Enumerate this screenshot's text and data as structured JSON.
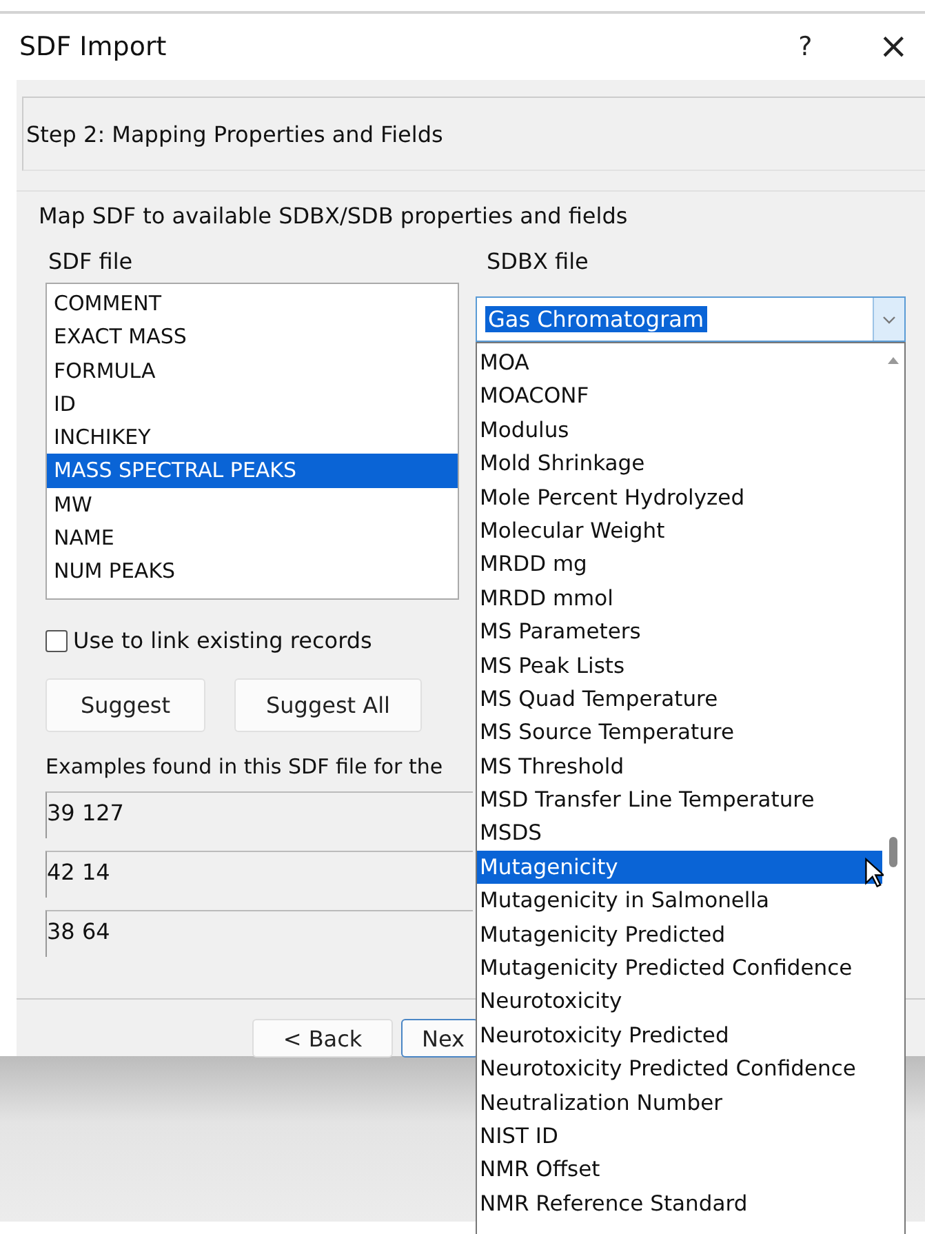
{
  "window": {
    "title": "SDF Import",
    "help": "?",
    "close": "×"
  },
  "step": {
    "title": "Step 2: Mapping Properties and Fields"
  },
  "group": {
    "title": "Map SDF to available SDBX/SDB properties and fields"
  },
  "sdf_file": {
    "label": "SDF file",
    "items": [
      {
        "label": "COMMENT",
        "selected": false
      },
      {
        "label": "EXACT MASS",
        "selected": false
      },
      {
        "label": "FORMULA",
        "selected": false
      },
      {
        "label": "ID",
        "selected": false
      },
      {
        "label": "INCHIKEY",
        "selected": false
      },
      {
        "label": "MASS SPECTRAL PEAKS",
        "selected": true
      },
      {
        "label": "MW",
        "selected": false
      },
      {
        "label": "NAME",
        "selected": false
      },
      {
        "label": "NUM PEAKS",
        "selected": false
      }
    ]
  },
  "link_checkbox": {
    "label": "Use to link existing records",
    "checked": false
  },
  "buttons": [
    "Suggest",
    "Suggest All"
  ],
  "examples": {
    "label": "Examples found in this SDF file for the",
    "values": [
      "39 127",
      "42 14",
      "38 64"
    ]
  },
  "nav_buttons": [
    "< Back",
    "Nex"
  ],
  "sdbx_file": {
    "label": "SDBX file",
    "value": "Gas Chromatogram",
    "options": [
      {
        "label": "MOA",
        "selected": false
      },
      {
        "label": "MOACONF",
        "selected": false
      },
      {
        "label": "Modulus",
        "selected": false
      },
      {
        "label": "Mold Shrinkage",
        "selected": false
      },
      {
        "label": "Mole Percent Hydrolyzed",
        "selected": false
      },
      {
        "label": "Molecular Weight",
        "selected": false
      },
      {
        "label": "MRDD mg",
        "selected": false
      },
      {
        "label": "MRDD mmol",
        "selected": false
      },
      {
        "label": "MS Parameters",
        "selected": false
      },
      {
        "label": "MS Peak Lists",
        "selected": false
      },
      {
        "label": "MS Quad Temperature",
        "selected": false
      },
      {
        "label": "MS Source Temperature",
        "selected": false
      },
      {
        "label": "MS Threshold",
        "selected": false
      },
      {
        "label": "MSD Transfer Line Temperature",
        "selected": false
      },
      {
        "label": "MSDS",
        "selected": false
      },
      {
        "label": "Mutagenicity",
        "selected": true
      },
      {
        "label": "Mutagenicity in Salmonella",
        "selected": false
      },
      {
        "label": "Mutagenicity Predicted",
        "selected": false
      },
      {
        "label": "Mutagenicity Predicted Confidence",
        "selected": false
      },
      {
        "label": "Neurotoxicity",
        "selected": false
      },
      {
        "label": "Neurotoxicity Predicted",
        "selected": false
      },
      {
        "label": "Neurotoxicity Predicted Confidence",
        "selected": false
      },
      {
        "label": "Neutralization Number",
        "selected": false
      },
      {
        "label": "NIST ID",
        "selected": false
      },
      {
        "label": "NMR Offset",
        "selected": false
      },
      {
        "label": "NMR Reference Standard",
        "selected": false
      }
    ]
  }
}
